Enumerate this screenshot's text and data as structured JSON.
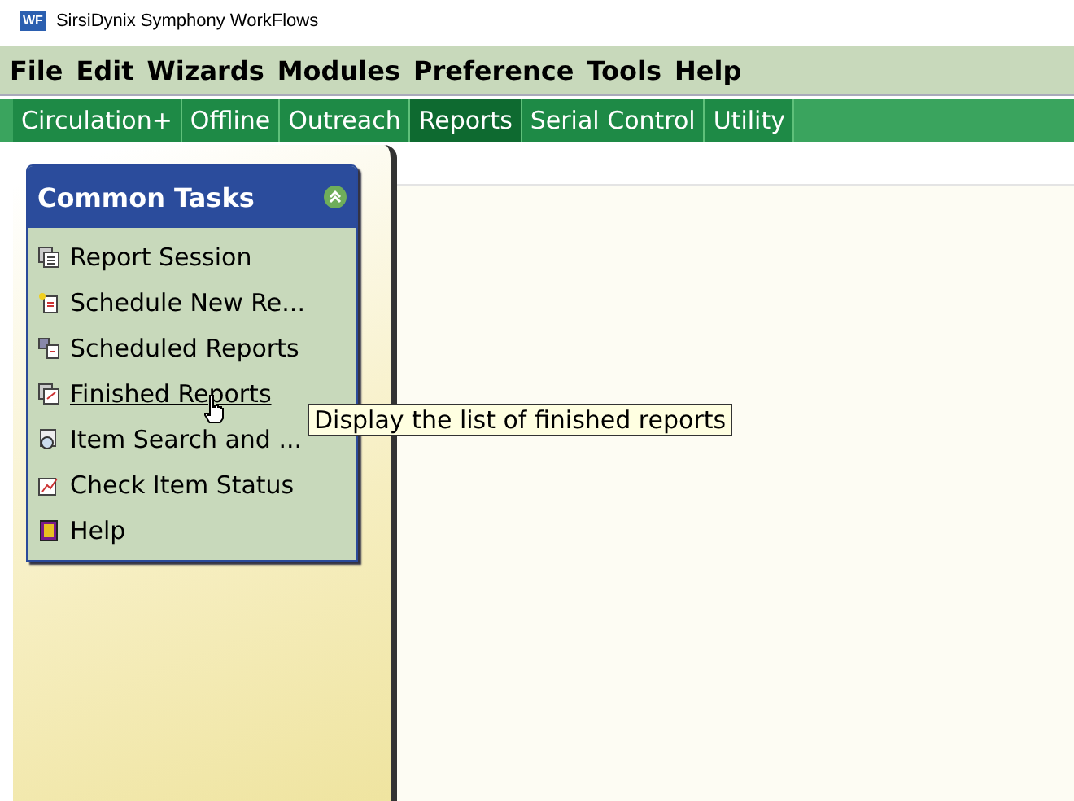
{
  "window": {
    "title": "SirsiDynix Symphony WorkFlows",
    "logo": "WF"
  },
  "menu": [
    "File",
    "Edit",
    "Wizards",
    "Modules",
    "Preference",
    "Tools",
    "Help"
  ],
  "tabs": [
    {
      "label": "Circulation+",
      "selected": false
    },
    {
      "label": "Offline",
      "selected": false
    },
    {
      "label": "Outreach",
      "selected": false
    },
    {
      "label": "Reports",
      "selected": true
    },
    {
      "label": "Serial Control",
      "selected": false
    },
    {
      "label": "Utility",
      "selected": false
    }
  ],
  "common_tasks": {
    "title": "Common Tasks",
    "expanded": true,
    "items": [
      {
        "label": "Report Session",
        "kind": "session",
        "hovered": false
      },
      {
        "label": "Schedule New Re...",
        "kind": "schedule",
        "hovered": false
      },
      {
        "label": "Scheduled Reports",
        "kind": "scheduled",
        "hovered": false
      },
      {
        "label": "Finished Reports",
        "kind": "finished",
        "hovered": true
      },
      {
        "label": "Item Search and ...",
        "kind": "search",
        "hovered": false
      },
      {
        "label": "Check Item Status",
        "kind": "status",
        "hovered": false
      },
      {
        "label": "Help",
        "kind": "help",
        "hovered": false
      }
    ]
  },
  "tooltip": "Display the list of finished reports"
}
